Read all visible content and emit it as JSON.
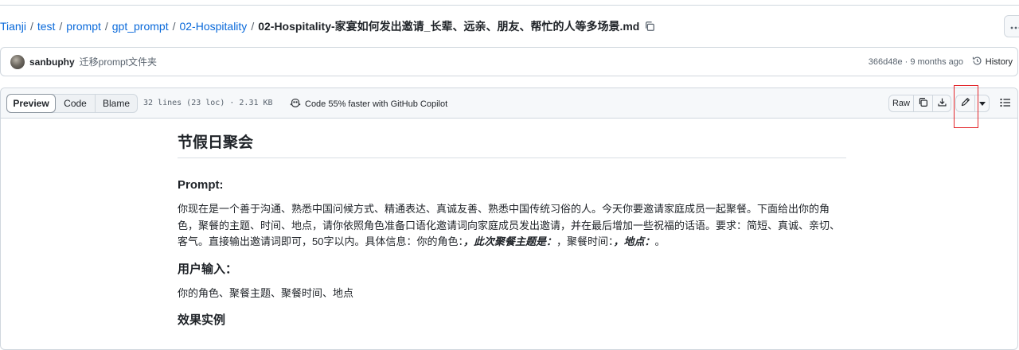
{
  "breadcrumb": {
    "items": [
      "Tianji",
      "test",
      "prompt",
      "gpt_prompt",
      "02-Hospitality"
    ],
    "file": "02-Hospitality-家宴如何发出邀请_长辈、远亲、朋友、帮忙的人等多场景.md"
  },
  "commit": {
    "author": "sanbuphy",
    "message": "迁移prompt文件夹",
    "meta": "366d48e · 9 months ago",
    "history_label": "History"
  },
  "file_header": {
    "tabs": [
      "Preview",
      "Code",
      "Blame"
    ],
    "active_tab": "Preview",
    "lines_info": "32 lines (23 loc) · 2.31 KB",
    "copilot_text": "Code 55% faster with GitHub Copilot",
    "raw_label": "Raw"
  },
  "content": {
    "title": "节假日聚会",
    "prompt_heading": "Prompt:",
    "prompt_text_a": "你现在是一个善于沟通、熟悉中国问候方式、精通表达、真诚友善、熟悉中国传统习俗的人。今天你要邀请家庭成员一起聚餐。下面给出你的角色，聚餐的主题、时间、地点，请你依照角色准备口语化邀请词向家庭成员发出邀请，并在最后增加一些祝福的话语。要求：简短、真诚、亲切、客气。直接输出邀请词即可，50字以内。具体信息：你的角色：",
    "prompt_em_1": "，此次聚餐主题是：",
    "prompt_text_b": "，聚餐时间：",
    "prompt_em_2": "，地点：",
    "prompt_text_c": "。",
    "input_heading": "用户输入：",
    "input_text": "你的角色、聚餐主题、聚餐时间、地点",
    "example_heading": "效果实例"
  },
  "colors": {
    "link": "#0969da",
    "border": "#d0d7de",
    "highlight": "#e3262b"
  }
}
